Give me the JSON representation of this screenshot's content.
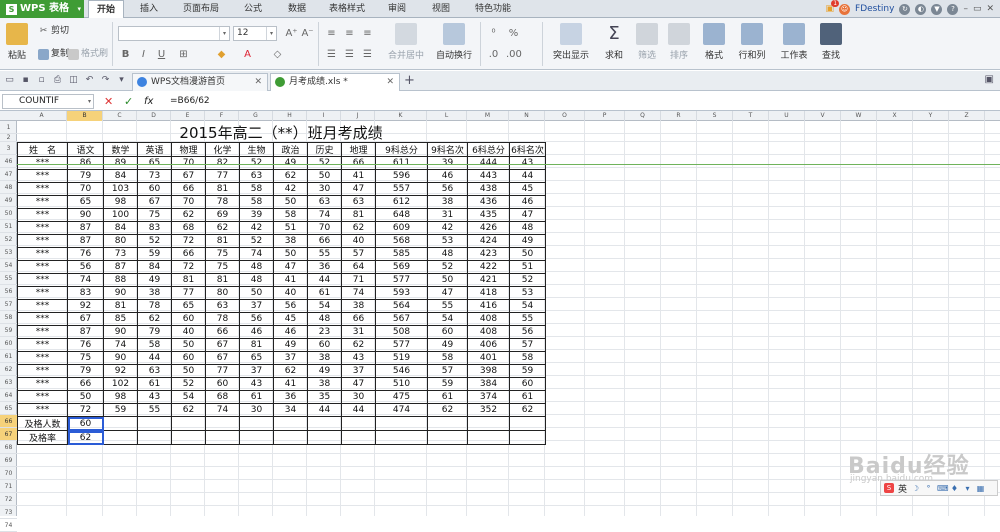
{
  "app": {
    "name": "WPS 表格",
    "user": "FDestiny",
    "notify_count": "1"
  },
  "menu": {
    "tabs": [
      "开始",
      "插入",
      "页面布局",
      "公式",
      "数据",
      "表格样式",
      "审阅",
      "视图",
      "特色功能"
    ],
    "active": 0
  },
  "ribbon": {
    "paste": "粘贴",
    "cut": "剪切",
    "copy": "复制",
    "format_painter": "格式刷",
    "font_size": "12",
    "bold": "B",
    "italic": "I",
    "underline": "U",
    "merge_center": "合并居中",
    "wrap_text": "自动换行",
    "percent": "%",
    "conditional": "突出显示",
    "sum": "求和",
    "filter": "筛选",
    "sort": "排序",
    "format": "格式",
    "rows_cols": "行和列",
    "worksheet": "工作表",
    "find": "查找"
  },
  "doc_tabs": [
    {
      "label": "WPS文档漫游首页",
      "color": "#3d83e0"
    },
    {
      "label": "月考成绩.xls *",
      "color": "#3f9c35"
    }
  ],
  "formula_bar": {
    "name_box": "COUNTIF",
    "formula": "=B66/62"
  },
  "columns": [
    "A",
    "B",
    "C",
    "D",
    "E",
    "F",
    "G",
    "H",
    "I",
    "J",
    "K",
    "L",
    "M",
    "N",
    "O",
    "P",
    "Q",
    "R",
    "S",
    "T",
    "U",
    "V",
    "W",
    "X",
    "Y",
    "Z"
  ],
  "selected_column": "B",
  "row_numbers": [
    "1",
    "2",
    "3",
    "46",
    "47",
    "48",
    "49",
    "50",
    "51",
    "52",
    "53",
    "54",
    "55",
    "56",
    "57",
    "58",
    "59",
    "60",
    "61",
    "62",
    "63",
    "64",
    "65",
    "66",
    "67",
    "68",
    "69",
    "70",
    "71",
    "72",
    "73",
    "74"
  ],
  "selected_rows": [
    "66",
    "67"
  ],
  "sheet": {
    "title": "2015年高二（**）班月考成绩",
    "headers": [
      "姓　名",
      "语文",
      "数学",
      "英语",
      "物理",
      "化学",
      "生物",
      "政治",
      "历史",
      "地理",
      "9科总分",
      "9科名次",
      "6科总分",
      "6科名次"
    ],
    "rows": [
      [
        "***",
        "86",
        "89",
        "65",
        "70",
        "82",
        "52",
        "49",
        "52",
        "66",
        "611",
        "39",
        "444",
        "43"
      ],
      [
        "***",
        "79",
        "84",
        "73",
        "67",
        "77",
        "63",
        "62",
        "50",
        "41",
        "596",
        "46",
        "443",
        "44"
      ],
      [
        "***",
        "70",
        "103",
        "60",
        "66",
        "81",
        "58",
        "42",
        "30",
        "47",
        "557",
        "56",
        "438",
        "45"
      ],
      [
        "***",
        "65",
        "98",
        "67",
        "70",
        "78",
        "58",
        "50",
        "63",
        "63",
        "612",
        "38",
        "436",
        "46"
      ],
      [
        "***",
        "90",
        "100",
        "75",
        "62",
        "69",
        "39",
        "58",
        "74",
        "81",
        "648",
        "31",
        "435",
        "47"
      ],
      [
        "***",
        "87",
        "84",
        "83",
        "68",
        "62",
        "42",
        "51",
        "70",
        "62",
        "609",
        "42",
        "426",
        "48"
      ],
      [
        "***",
        "87",
        "80",
        "52",
        "72",
        "81",
        "52",
        "38",
        "66",
        "40",
        "568",
        "53",
        "424",
        "49"
      ],
      [
        "***",
        "76",
        "73",
        "59",
        "66",
        "75",
        "74",
        "50",
        "55",
        "57",
        "585",
        "48",
        "423",
        "50"
      ],
      [
        "***",
        "56",
        "87",
        "84",
        "72",
        "75",
        "48",
        "47",
        "36",
        "64",
        "569",
        "52",
        "422",
        "51"
      ],
      [
        "***",
        "74",
        "88",
        "49",
        "81",
        "81",
        "48",
        "41",
        "44",
        "71",
        "577",
        "50",
        "421",
        "52"
      ],
      [
        "***",
        "83",
        "90",
        "38",
        "77",
        "80",
        "50",
        "40",
        "61",
        "74",
        "593",
        "47",
        "418",
        "53"
      ],
      [
        "***",
        "92",
        "81",
        "78",
        "65",
        "63",
        "37",
        "56",
        "54",
        "38",
        "564",
        "55",
        "416",
        "54"
      ],
      [
        "***",
        "67",
        "85",
        "62",
        "60",
        "78",
        "56",
        "45",
        "48",
        "66",
        "567",
        "54",
        "408",
        "55"
      ],
      [
        "***",
        "87",
        "90",
        "79",
        "40",
        "66",
        "46",
        "46",
        "23",
        "31",
        "508",
        "60",
        "408",
        "56"
      ],
      [
        "***",
        "76",
        "74",
        "58",
        "50",
        "67",
        "81",
        "49",
        "60",
        "62",
        "577",
        "49",
        "406",
        "57"
      ],
      [
        "***",
        "75",
        "90",
        "44",
        "60",
        "67",
        "65",
        "37",
        "38",
        "43",
        "519",
        "58",
        "401",
        "58"
      ],
      [
        "***",
        "79",
        "92",
        "63",
        "50",
        "77",
        "37",
        "62",
        "49",
        "37",
        "546",
        "57",
        "398",
        "59"
      ],
      [
        "***",
        "66",
        "102",
        "61",
        "52",
        "60",
        "43",
        "41",
        "38",
        "47",
        "510",
        "59",
        "384",
        "60"
      ],
      [
        "***",
        "50",
        "98",
        "43",
        "54",
        "68",
        "61",
        "36",
        "35",
        "30",
        "475",
        "61",
        "374",
        "61"
      ],
      [
        "***",
        "72",
        "59",
        "55",
        "62",
        "74",
        "30",
        "34",
        "44",
        "44",
        "474",
        "62",
        "352",
        "62"
      ]
    ],
    "summary": [
      {
        "label": "及格人数",
        "value": "60"
      },
      {
        "label": "及格率",
        "value": "62"
      }
    ]
  },
  "watermark": {
    "main": "Baidu经验",
    "sub": "jingyan.baidu.com"
  },
  "ime": {
    "label": "英"
  }
}
